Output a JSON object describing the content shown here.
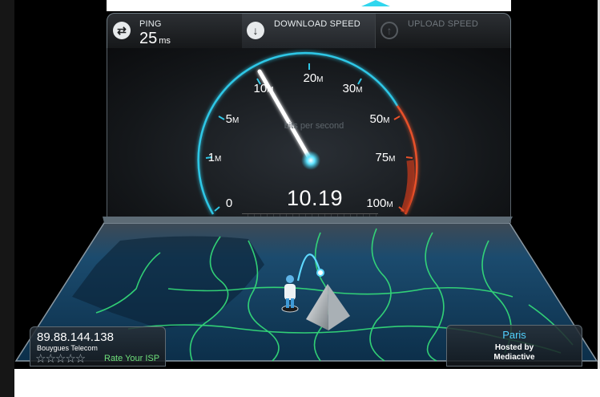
{
  "ping": {
    "label": "PING",
    "value": "25",
    "unit": "ms"
  },
  "download": {
    "label": "DOWNLOAD SPEED"
  },
  "upload": {
    "label": "UPLOAD SPEED"
  },
  "gauge": {
    "unit_text": "bits per second",
    "speed_value": "10.19",
    "tick_labels": [
      {
        "value": "0",
        "unit": ""
      },
      {
        "value": "1",
        "unit": "M"
      },
      {
        "value": "5",
        "unit": "M"
      },
      {
        "value": "10",
        "unit": "M"
      },
      {
        "value": "20",
        "unit": "M"
      },
      {
        "value": "30",
        "unit": "M"
      },
      {
        "value": "50",
        "unit": "M"
      },
      {
        "value": "75",
        "unit": "M"
      },
      {
        "value": "100",
        "unit": "M"
      }
    ],
    "progress_fraction": 0.17,
    "accent_color": "#2fc7e6",
    "danger_color": "#e8512a"
  },
  "isp": {
    "ip": "89.88.144.138",
    "name": "Bouygues Telecom",
    "stars": "☆☆☆☆☆",
    "rate_label": "Rate Your ISP"
  },
  "server": {
    "city": "Paris",
    "hosted_by_label": "Hosted by",
    "host": "Mediactive"
  }
}
